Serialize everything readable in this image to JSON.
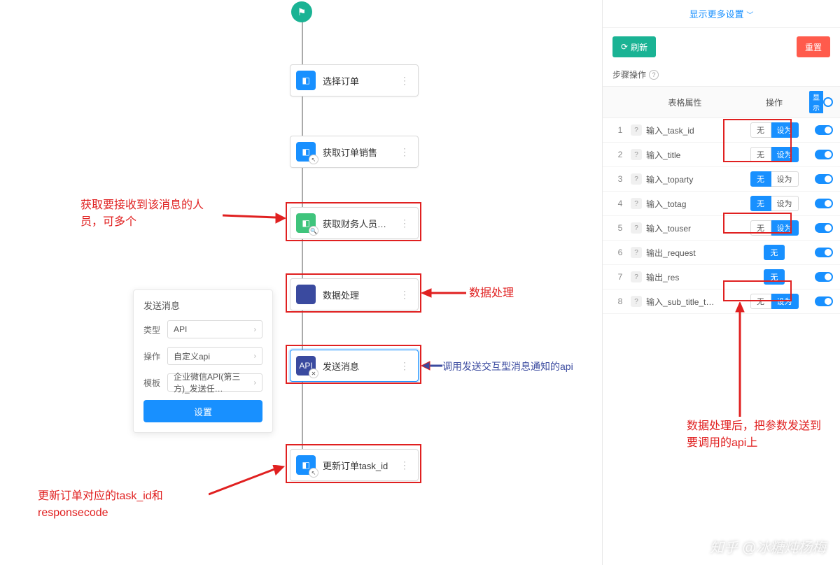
{
  "flow": {
    "start_icon": "▶",
    "nodes": [
      {
        "label": "选择订单",
        "icon": "cube",
        "color": "blue",
        "corner": ""
      },
      {
        "label": "获取订单销售",
        "icon": "cube",
        "color": "blue",
        "corner": "↖"
      },
      {
        "label": "获取财务人员…",
        "icon": "cube",
        "color": "green",
        "corner": "🔍"
      },
      {
        "label": "数据处理",
        "icon": "code",
        "color": "navy",
        "corner": ""
      },
      {
        "label": "发送消息",
        "icon": "api",
        "color": "navy",
        "corner": "✕",
        "selected": true
      },
      {
        "label": "更新订单task_id",
        "icon": "cube",
        "color": "blue",
        "corner": "↖"
      }
    ]
  },
  "popup": {
    "title": "发送消息",
    "rows": [
      {
        "label": "类型",
        "value": "API"
      },
      {
        "label": "操作",
        "value": "自定义api"
      },
      {
        "label": "模板",
        "value": "企业微信API(第三方)_发送任…"
      }
    ],
    "button": "设置"
  },
  "annotations": {
    "recv": "获取要接收到该消息的人员，可多个",
    "data_proc": "数据处理",
    "call_api": "调用发送交互型消息通知的api",
    "update": "更新订单对应的task_id和responsecode",
    "after": "数据处理后，把参数发送到要调用的api上"
  },
  "sidebar": {
    "more": "显示更多设置",
    "refresh": "刷新",
    "reset": "重置",
    "section": "步骤操作",
    "head_attr": "表格属性",
    "head_op": "操作",
    "display_label": "显示",
    "pill_none": "无",
    "pill_set": "设为",
    "rows": [
      {
        "idx": "1",
        "name": "输入_task_id",
        "none_active": false,
        "has_set": true
      },
      {
        "idx": "2",
        "name": "输入_title",
        "none_active": false,
        "has_set": true
      },
      {
        "idx": "3",
        "name": "输入_toparty",
        "none_active": true,
        "has_set": true
      },
      {
        "idx": "4",
        "name": "输入_totag",
        "none_active": true,
        "has_set": true
      },
      {
        "idx": "5",
        "name": "输入_touser",
        "none_active": false,
        "has_set": true
      },
      {
        "idx": "6",
        "name": "输出_request",
        "none_active": true,
        "has_set": false
      },
      {
        "idx": "7",
        "name": "输出_res",
        "none_active": true,
        "has_set": false
      },
      {
        "idx": "8",
        "name": "输入_sub_title_t…",
        "none_active": false,
        "has_set": true
      }
    ]
  },
  "watermark": "知乎 @冰糖炖杨梅"
}
